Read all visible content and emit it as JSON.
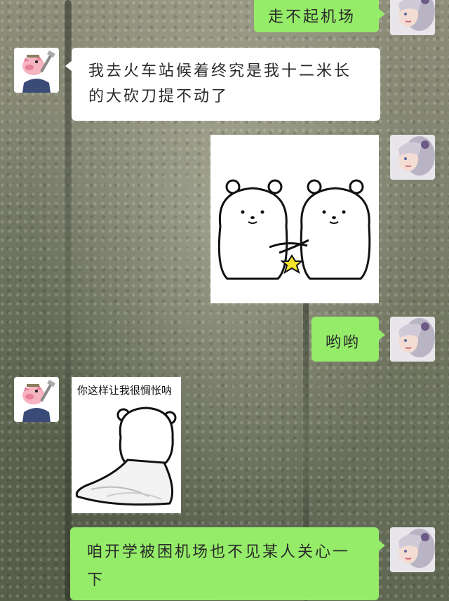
{
  "messages": [
    {
      "side": "right",
      "type": "text",
      "text": "走不起机场"
    },
    {
      "side": "left",
      "type": "text",
      "text": "我去火车站候着终究是我十二米长的大砍刀提不动了"
    },
    {
      "side": "right",
      "type": "sticker",
      "sticker": "two-bears-high-five-sticker"
    },
    {
      "side": "right",
      "type": "text",
      "text": "哟哟"
    },
    {
      "side": "left",
      "type": "sticker",
      "sticker": "bear-with-cape-sticker",
      "caption": "你这样让我很惆怅呐"
    },
    {
      "side": "right",
      "type": "text",
      "text": "咱开学被困机场也不见某人关心一下"
    }
  ],
  "colors": {
    "sent_bubble": "#95ec69",
    "received_bubble": "#ffffff",
    "star": "#f5e22a"
  },
  "avatars": {
    "self": "woman-avatar",
    "friend": "pig-avatar"
  }
}
